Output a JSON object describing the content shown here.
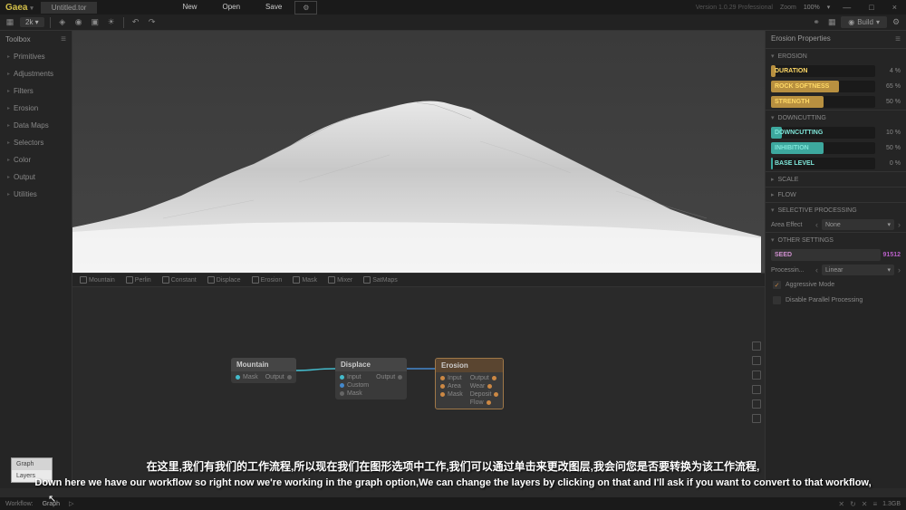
{
  "titlebar": {
    "logo": "Gaea",
    "filename": "Untitled.tor",
    "menu": {
      "new": "New",
      "open": "Open",
      "save": "Save"
    },
    "version": "Version 1.0.29 Professional",
    "zoom_label": "Zoom",
    "zoom_value": "100%"
  },
  "toolbar": {
    "resolution": "2k",
    "build": "Build"
  },
  "sidebar": {
    "header": "Toolbox",
    "items": [
      "Primitives",
      "Adjustments",
      "Filters",
      "Erosion",
      "Data Maps",
      "Selectors",
      "Color",
      "Output",
      "Utilities"
    ]
  },
  "node_toolbar": [
    "Mountain",
    "Perlin",
    "Constant",
    "Displace",
    "Erosion",
    "Mask",
    "Mixer",
    "SatMaps"
  ],
  "nodes": {
    "mountain": {
      "title": "Mountain",
      "in": [
        {
          "label": "Mask",
          "color": "cyan"
        }
      ],
      "out": [
        {
          "label": "Output",
          "color": "grey"
        }
      ]
    },
    "displace": {
      "title": "Displace",
      "in": [
        {
          "label": "Input",
          "color": "cyan"
        },
        {
          "label": "Custom",
          "color": "blue"
        },
        {
          "label": "Mask",
          "color": "grey"
        }
      ],
      "out": [
        {
          "label": "Output",
          "color": "grey"
        }
      ]
    },
    "erosion": {
      "title": "Erosion",
      "in": [
        {
          "label": "Input",
          "color": "orange"
        },
        {
          "label": "Area",
          "color": "orange"
        },
        {
          "label": "Mask",
          "color": "orange"
        }
      ],
      "out": [
        {
          "label": "Output",
          "color": "orange"
        },
        {
          "label": "Wear",
          "color": "orange"
        },
        {
          "label": "Deposit",
          "color": "orange"
        },
        {
          "label": "Flow",
          "color": "orange"
        }
      ]
    }
  },
  "props": {
    "header": "Erosion Properties",
    "sections": {
      "erosion": "EROSION",
      "downcutting": "DOWNCUTTING",
      "scale": "SCALE",
      "flow": "FLOW",
      "selective": "SELECTIVE PROCESSING",
      "other": "OTHER SETTINGS"
    },
    "sliders": {
      "duration": {
        "label": "DURATION",
        "value": "4",
        "unit": "%",
        "fill": 4
      },
      "rock_softness": {
        "label": "ROCK SOFTNESS",
        "value": "65",
        "unit": "%",
        "fill": 65
      },
      "strength": {
        "label": "STRENGTH",
        "value": "50",
        "unit": "%",
        "fill": 50
      },
      "downcutting": {
        "label": "DOWNCUTTING",
        "value": "10",
        "unit": "%",
        "fill": 10
      },
      "inhibition": {
        "label": "INHIBITION",
        "value": "50",
        "unit": "%",
        "fill": 50
      },
      "base_level": {
        "label": "BASE LEVEL",
        "value": "0",
        "unit": "%",
        "fill": 2
      }
    },
    "area_effect": {
      "label": "Area Effect",
      "value": "None"
    },
    "seed": {
      "label": "SEED",
      "value": "91512"
    },
    "processing": {
      "label": "Processin...",
      "value": "Linear"
    },
    "aggressive": "Aggressive Mode",
    "disable_parallel": "Disable Parallel Processing"
  },
  "workflow_popup": {
    "graph": "Graph",
    "layers": "Layers"
  },
  "statusbar": {
    "workflow": "Workflow:",
    "graph": "Graph",
    "mem": "1.3GB"
  },
  "subtitles": {
    "cn": "在这里,我们有我们的工作流程,所以现在我们在图形选项中工作,我们可以通过单击来更改图层,我会问您是否要转换为该工作流程,",
    "en": "Down here we have our workflow so right now we're working in the graph option,We can change the layers by clicking on that and I'll ask if you want to convert to that workflow,"
  }
}
